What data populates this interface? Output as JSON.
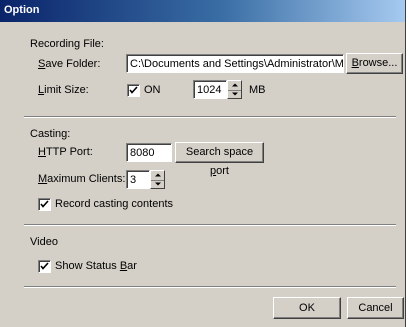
{
  "window": {
    "title": "Option"
  },
  "recording": {
    "section_label": "Recording File:",
    "save_folder_label": "Save Folder:",
    "save_folder_value": "C:\\Documents and Settings\\Administrator\\My Do",
    "browse_label": "Browse...",
    "limit_size_label": "Limit Size:",
    "limit_on_label": "ON",
    "limit_on_checked": true,
    "limit_value": "1024",
    "limit_unit": "MB"
  },
  "casting": {
    "section_label": "Casting:",
    "http_port_label": "HTTP Port:",
    "http_port_value": "8080",
    "search_port_label": "Search space port",
    "max_clients_label": "Maximum Clients:",
    "max_clients_value": "3",
    "record_contents_label": "Record casting contents",
    "record_contents_checked": true
  },
  "video": {
    "section_label": "Video",
    "status_bar_label": "Show Status Bar",
    "status_bar_checked": true
  },
  "footer": {
    "ok_label": "OK",
    "cancel_label": "Cancel"
  },
  "colors": {
    "title_start": "#0a246a",
    "title_end": "#a6caf0",
    "dialog_face": "#d4d0c8"
  }
}
